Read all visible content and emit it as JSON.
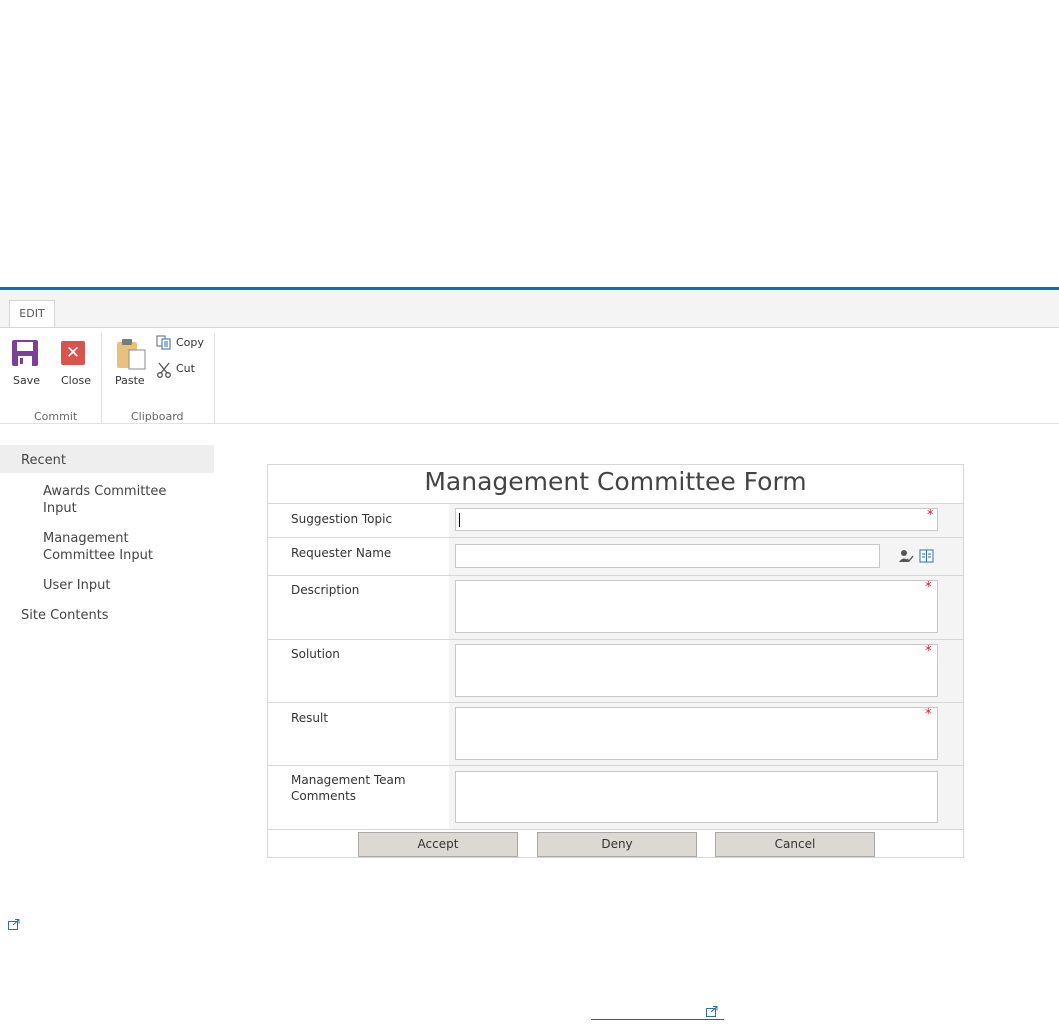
{
  "ribbon": {
    "tab_edit": "EDIT",
    "save_label": "Save",
    "close_label": "Close",
    "paste_label": "Paste",
    "copy_label": "Copy",
    "cut_label": "Cut",
    "group_commit": "Commit",
    "group_clipboard": "Clipboard"
  },
  "nav": {
    "recent": "Recent",
    "items": [
      "Awards Committee Input",
      "Management Committee Input",
      "User Input"
    ],
    "site_contents": "Site Contents"
  },
  "form": {
    "title": "Management Committee Form",
    "fields": {
      "suggestion_topic": "Suggestion Topic",
      "requester_name": "Requester Name",
      "description": "Description",
      "solution": "Solution",
      "result": "Result",
      "mgmt_comments": "Management Team Comments"
    },
    "required_mark": "*",
    "buttons": {
      "accept": "Accept",
      "deny": "Deny",
      "cancel": "Cancel"
    }
  },
  "colors": {
    "accent": "#0072c6",
    "required": "#e81123",
    "button_bg": "#dcd9d5"
  }
}
